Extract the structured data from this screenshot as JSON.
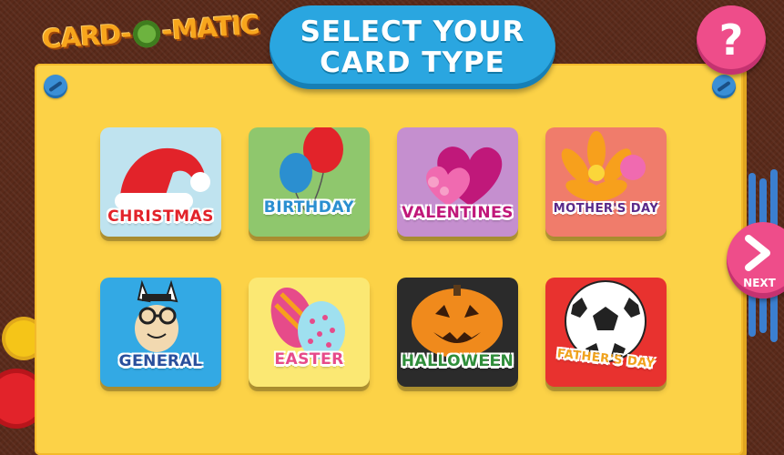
{
  "app": {
    "logo_text": "CARD-O-MATIC",
    "logo_parts": [
      "CARD-",
      "-MATIC"
    ]
  },
  "header": {
    "title_line1": "SELECT YOUR",
    "title_line2": "CARD TYPE"
  },
  "help_button": {
    "label": "?"
  },
  "next_button": {
    "label": "NEXT"
  },
  "cards": [
    {
      "label": "CHRISTMAS",
      "bg": "#bfe3ef",
      "label_color": "#e2232a",
      "icon": "santa-hat-icon"
    },
    {
      "label": "BIRTHDAY",
      "bg": "#8fc76d",
      "label_color": "#2b8fd0",
      "icon": "balloons-icon"
    },
    {
      "label": "VALENTINES",
      "bg": "#c58fcf",
      "label_color": "#c0187a",
      "icon": "hearts-icon"
    },
    {
      "label": "MOTHER'S DAY",
      "bg": "#f07c6b",
      "label_color": "#5a2a8a",
      "icon": "flower-icon"
    },
    {
      "label": "GENERAL",
      "bg": "#33a9e4",
      "label_color": "#2a4f9c",
      "icon": "zebra-icon"
    },
    {
      "label": "EASTER",
      "bg": "#fbe873",
      "label_color": "#e64b8a",
      "icon": "easter-eggs-icon"
    },
    {
      "label": "HALLOWEEN",
      "bg": "#2b2b2b",
      "label_color": "#2f8d3a",
      "icon": "pumpkin-icon"
    },
    {
      "label": "FATHER'S DAY",
      "bg": "#e8322f",
      "label_color": "#f0a21c",
      "icon": "soccer-ball-icon"
    }
  ],
  "colors": {
    "board": "#fcd247",
    "title_pill": "#2aa6e0",
    "pink_button": "#ee4d8a",
    "background": "#5a2a1a"
  }
}
